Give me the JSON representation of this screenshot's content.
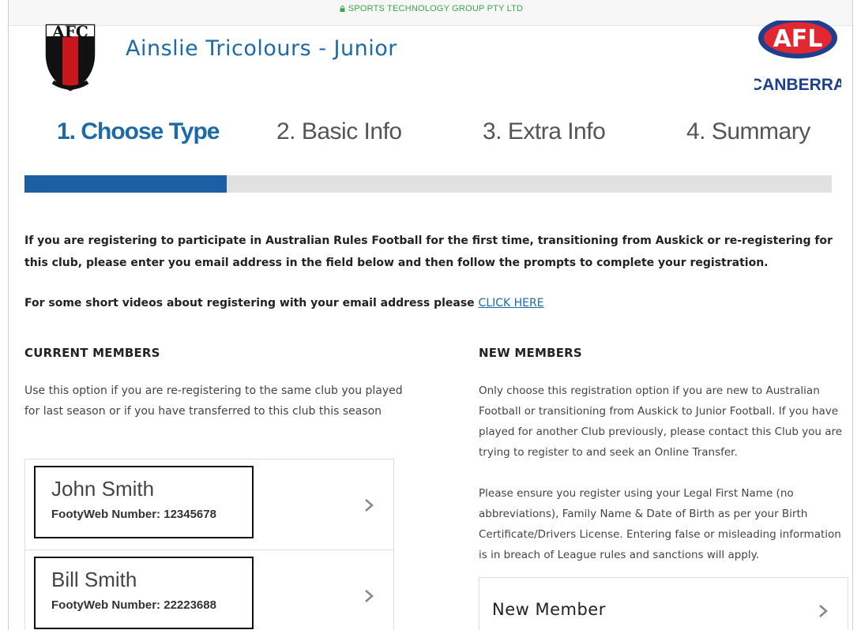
{
  "url_bar": {
    "text": "SPORTS TECHNOLOGY GROUP PTY LTD",
    "icon": "lock-icon",
    "color": "#3aa64a"
  },
  "header": {
    "club_logo": {
      "icon": "club-shield-logo",
      "text": "AFC"
    },
    "club_title": "Ainslie Tricolours - Junior",
    "league_logo": {
      "icon": "league-logo",
      "text_top": "AFL",
      "text_bottom": "CANBERRA"
    }
  },
  "steps": [
    {
      "label": "1. Choose Type",
      "active": true
    },
    {
      "label": "2. Basic Info",
      "active": false
    },
    {
      "label": "3. Extra Info",
      "active": false
    },
    {
      "label": "4. Summary",
      "active": false
    }
  ],
  "progress": {
    "value_fraction": 0.25,
    "accent": "#1c5fa3"
  },
  "intro_text": "If you are registering to participate in Australian Rules Football for the first time, transitioning from Auskick or re-registering for this club, please enter you email address in the field below and then follow the prompts to complete your registration.",
  "videos": {
    "text": "For some short videos about registering with your email address please ",
    "link_label": "CLICK HERE"
  },
  "current_members": {
    "heading": "CURRENT MEMBERS",
    "description": "Use this option if you are re-registering to the same club you played for last season or if you have transferred to this club this season",
    "members": [
      {
        "name": "John Smith",
        "number": "FootyWeb Number: 12345678"
      },
      {
        "name": "Bill Smith",
        "number": "FootyWeb Number: 22223688"
      }
    ]
  },
  "new_members": {
    "heading": "NEW MEMBERS",
    "paragraph_1": "Only choose this registration option if you are new to Australian Football or transitioning from Auskick to Junior Football. If you have played for another Club previously, please contact this Club you are trying to register to and seek an Online Transfer.",
    "paragraph_2": "Please ensure you register using your Legal First Name (no abbreviations), Family Name & Date of Birth as per your Birth Certificate/Drivers License. Entering false or misleading information is in breach of League rules and sanctions will apply.",
    "button_label": "New Member"
  },
  "colors": {
    "brand_blue": "#1c6aa8",
    "league_red": "#e1272f",
    "league_navy": "#1d3f8f"
  }
}
